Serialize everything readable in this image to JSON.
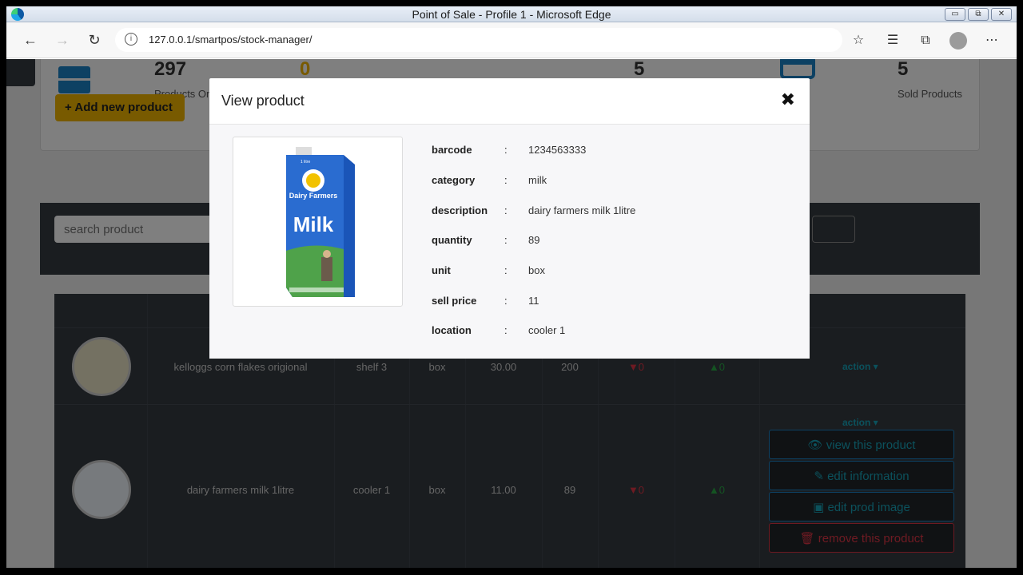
{
  "window": {
    "title": "Point of Sale - Profile 1 - Microsoft Edge"
  },
  "browser": {
    "url": "127.0.0.1/smartpos/stock-manager/"
  },
  "stats": {
    "products_count": "297",
    "products_label": "Products On",
    "out_count": "0",
    "alert_count": "5",
    "sold_count": "5",
    "sold_label": "Sold Products",
    "add_button": "+ Add new product"
  },
  "search": {
    "placeholder": "search product"
  },
  "table": {
    "rows": [
      {
        "description": "kelloggs corn flakes origional",
        "location": "shelf 3",
        "unit": "box",
        "price": "30.00",
        "qty": "200",
        "down": "▼0",
        "up": "▲0",
        "action": "action ▾"
      },
      {
        "description": "dairy farmers milk 1litre",
        "location": "cooler 1",
        "unit": "box",
        "price": "11.00",
        "qty": "89",
        "down": "▼0",
        "up": "▲0",
        "action": "action ▾"
      }
    ],
    "action_menu": {
      "view": "view this product",
      "edit": "edit information",
      "image": "edit prod image",
      "remove": "remove this product"
    }
  },
  "modal": {
    "title": "View product",
    "close": "✖",
    "image_text": {
      "brand": "Dairy Farmers",
      "product": "Milk",
      "size": "1 litre"
    },
    "fields": [
      {
        "key": "barcode",
        "value": "1234563333"
      },
      {
        "key": "category",
        "value": "milk"
      },
      {
        "key": "description",
        "value": "dairy farmers milk 1litre"
      },
      {
        "key": "quantity",
        "value": "89"
      },
      {
        "key": "unit",
        "value": "box"
      },
      {
        "key": "sell price",
        "value": "11"
      },
      {
        "key": "location",
        "value": "cooler 1"
      }
    ]
  },
  "colors": {
    "accent": "#17a2b8",
    "warning": "#f0b400",
    "danger": "#dc3545",
    "primary": "#1b82c6",
    "dark": "#343a40"
  }
}
